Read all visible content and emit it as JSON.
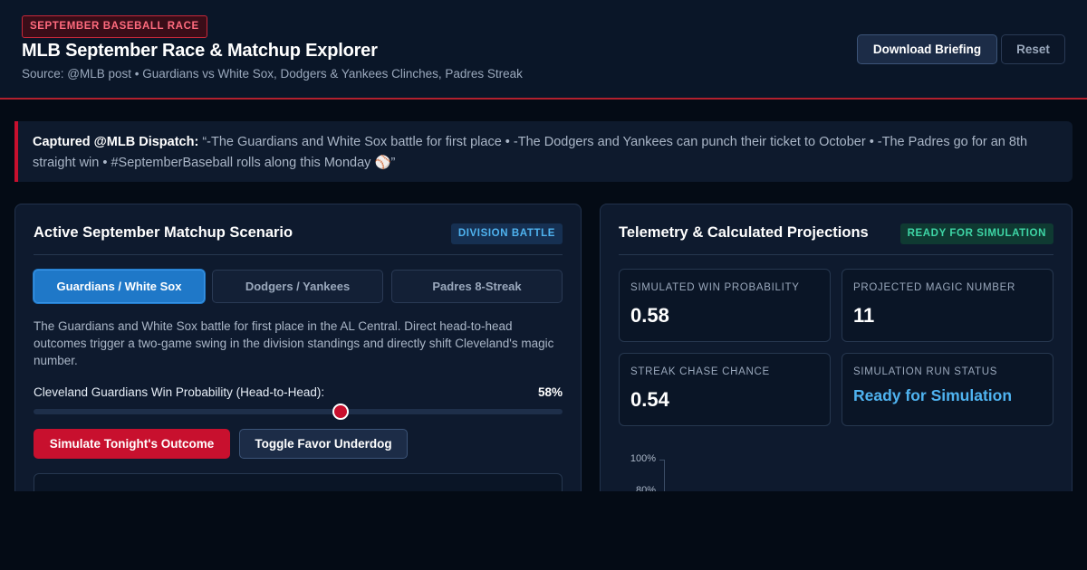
{
  "header": {
    "badge": "SEPTEMBER BASEBALL RACE",
    "title": "MLB September Race & Matchup Explorer",
    "source": "Source: @MLB post • Guardians vs White Sox, Dodgers & Yankees Clinches, Padres Streak",
    "download_label": "Download Briefing",
    "reset_label": "Reset"
  },
  "dispatch": {
    "lead": "Captured @MLB Dispatch:",
    "quote": " “-The Guardians and White Sox battle for first place • -The Dodgers and Yankees can punch their ticket to October • -The Padres go for an 8th straight win • #SeptemberBaseball rolls along this Monday ⚾”"
  },
  "scenario": {
    "title": "Active September Matchup Scenario",
    "tag": "DIVISION BATTLE",
    "tabs": [
      {
        "label": "Guardians / White Sox",
        "active": true
      },
      {
        "label": "Dodgers / Yankees",
        "active": false
      },
      {
        "label": "Padres 8-Streak",
        "active": false
      }
    ],
    "description": "The Guardians and White Sox battle for first place in the AL Central. Direct head-to-head outcomes trigger a two-game swing in the division standings and directly shift Cleveland's magic number.",
    "slider_label": "Cleveland Guardians Win Probability (Head-to-Head):",
    "slider_value_text": "58%",
    "slider_fraction": 0.58,
    "simulate_label": "Simulate Tonight's Outcome",
    "toggle_label": "Toggle Favor Underdog"
  },
  "telemetry": {
    "title": "Telemetry & Calculated Projections",
    "tag": "READY FOR SIMULATION",
    "metrics": [
      {
        "label": "SIMULATED WIN PROBABILITY",
        "value": "0.58"
      },
      {
        "label": "PROJECTED MAGIC NUMBER",
        "value": "11"
      },
      {
        "label": "STREAK CHASE CHANCE",
        "value": "0.54"
      },
      {
        "label": "SIMULATION RUN STATUS",
        "value": "Ready for Simulation"
      }
    ],
    "chart_ticks": [
      "100%",
      "80%"
    ]
  },
  "colors": {
    "accent_red": "#c8102e",
    "accent_blue": "#1f78c8",
    "status_cyan": "#4fb3f0",
    "ready_green": "#3ed6a6"
  }
}
